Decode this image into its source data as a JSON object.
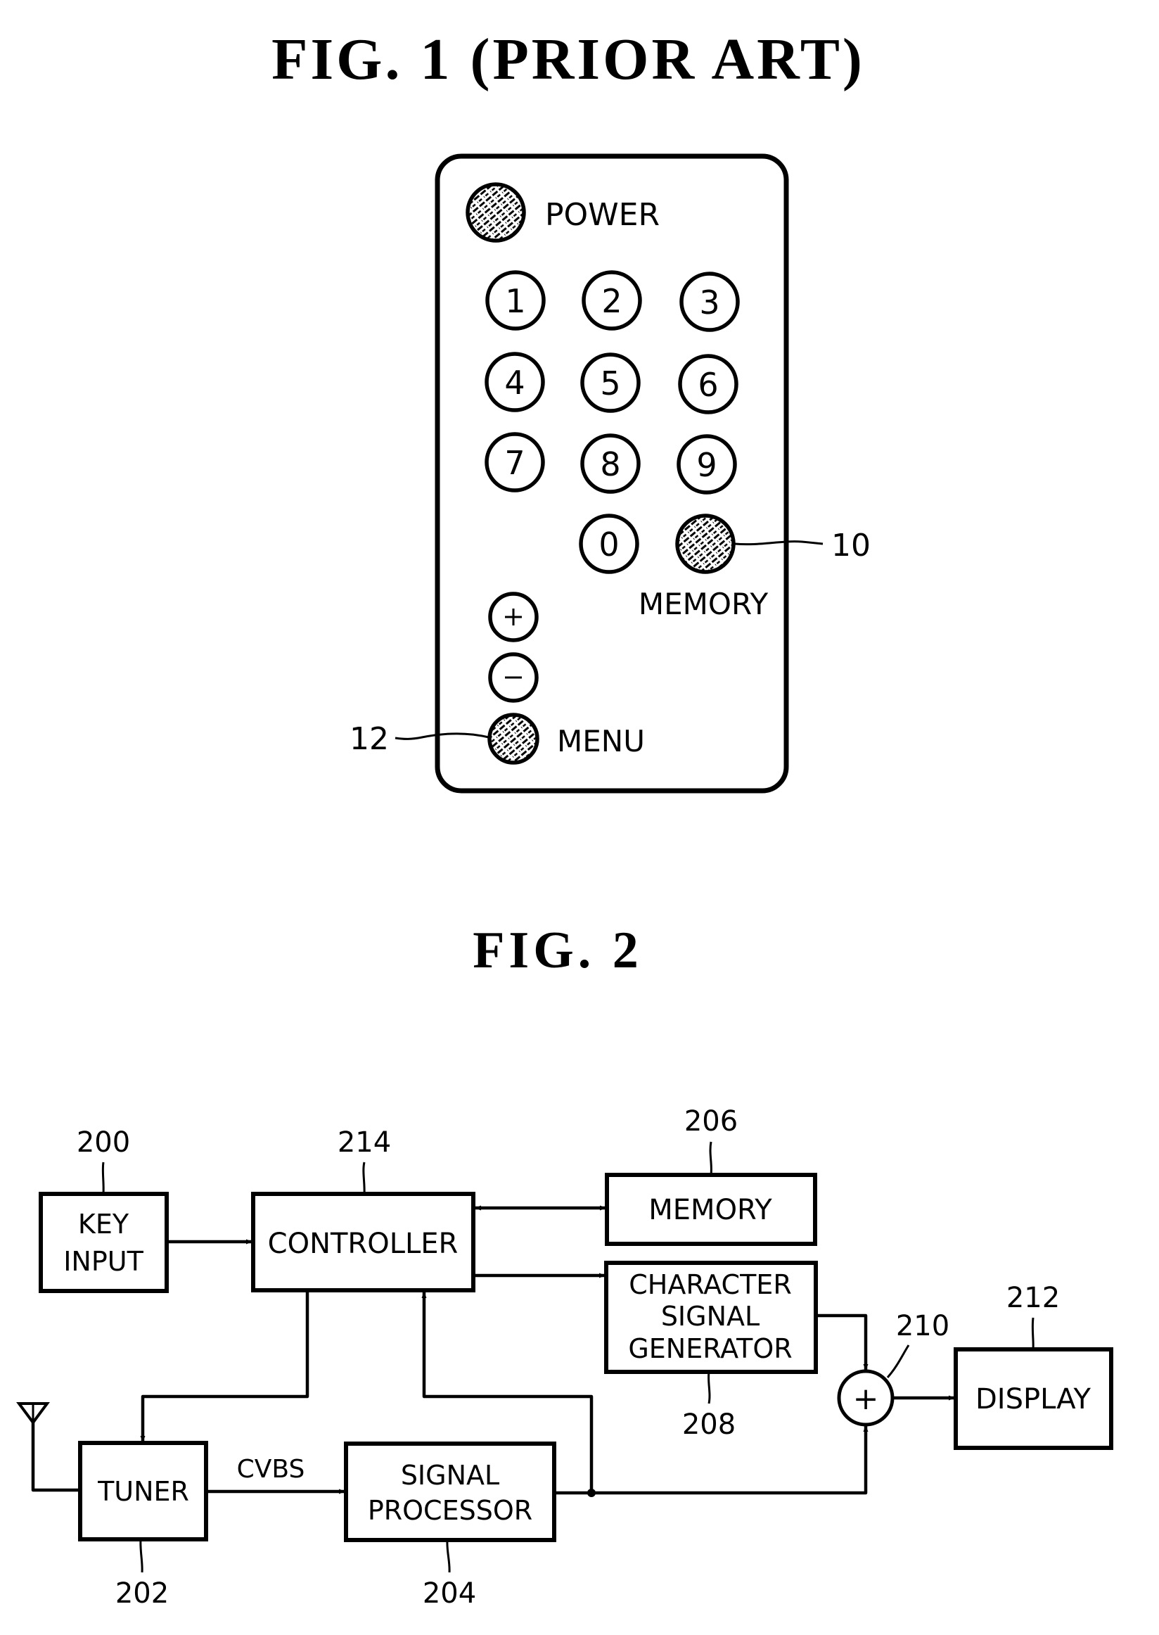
{
  "fig1": {
    "title": "FIG. 1 (PRIOR ART)",
    "remote": {
      "power_label": "POWER",
      "number_keys": [
        "1",
        "2",
        "3",
        "4",
        "5",
        "6",
        "7",
        "8",
        "9",
        "0"
      ],
      "memory_label": "MEMORY",
      "plus_symbol": "+",
      "minus_symbol": "−",
      "menu_label": "MENU",
      "ref_memory_button": "10",
      "ref_menu_button": "12"
    }
  },
  "fig2": {
    "title": "FIG. 2",
    "blocks": {
      "key_input": {
        "line1": "KEY",
        "line2": "INPUT",
        "ref": "200"
      },
      "controller": {
        "label": "CONTROLLER",
        "ref": "214"
      },
      "memory": {
        "label": "MEMORY",
        "ref": "206"
      },
      "char_gen": {
        "line1": "CHARACTER",
        "line2": "SIGNAL",
        "line3": "GENERATOR",
        "ref": "208"
      },
      "adder": {
        "symbol": "+",
        "ref": "210"
      },
      "display": {
        "label": "DISPLAY",
        "ref": "212"
      },
      "tuner": {
        "label": "TUNER",
        "ref": "202"
      },
      "signal_processor": {
        "line1": "SIGNAL",
        "line2": "PROCESSOR",
        "ref": "204"
      }
    },
    "signal_labels": {
      "tuner_to_processor": "CVBS"
    }
  }
}
